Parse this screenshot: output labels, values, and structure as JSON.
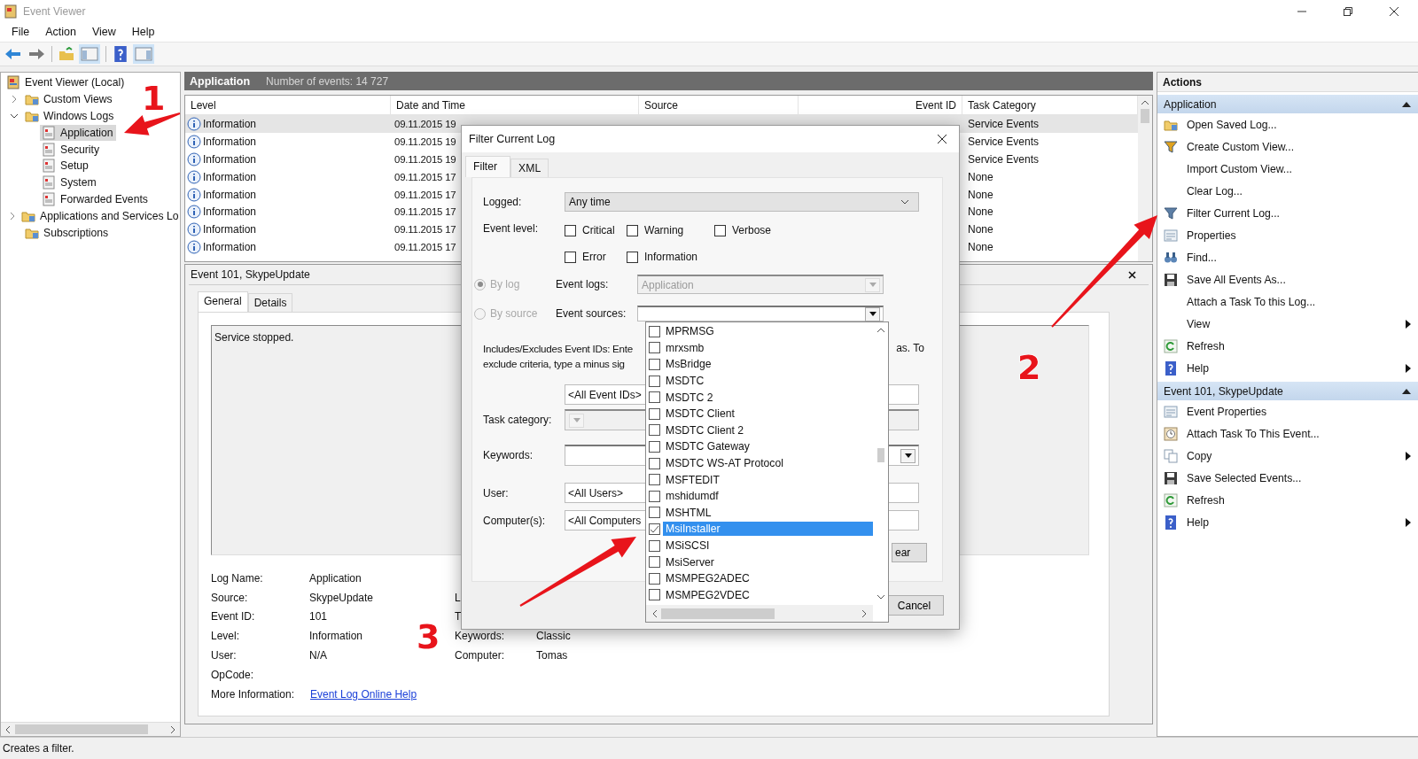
{
  "window": {
    "title": "Event Viewer"
  },
  "menu": [
    "File",
    "Action",
    "View",
    "Help"
  ],
  "tree": [
    {
      "label": "Event Viewer (Local)",
      "kind": "root",
      "selected": false,
      "children": [
        {
          "label": "Custom Views",
          "kind": "folder",
          "expanded": false,
          "selected": false
        },
        {
          "label": "Windows Logs",
          "kind": "folder",
          "expanded": true,
          "selected": false,
          "children": [
            {
              "label": "Application",
              "kind": "log",
              "selected": true
            },
            {
              "label": "Security",
              "kind": "log",
              "selected": false
            },
            {
              "label": "Setup",
              "kind": "log",
              "selected": false
            },
            {
              "label": "System",
              "kind": "log",
              "selected": false
            },
            {
              "label": "Forwarded Events",
              "kind": "log",
              "selected": false
            }
          ]
        },
        {
          "label": "Applications and Services Lo",
          "kind": "folder",
          "expanded": false,
          "selected": false
        },
        {
          "label": "Subscriptions",
          "kind": "plain-folder",
          "selected": false
        }
      ]
    }
  ],
  "log_header": {
    "name": "Application",
    "count": "Number of events: 14 727"
  },
  "events": {
    "columns": [
      "Level",
      "Date and Time",
      "Source",
      "Event ID",
      "Task Category"
    ],
    "rows": [
      {
        "level": "Information",
        "date_time": "09.11.2015 19",
        "task_category": "Service Events",
        "selected": true
      },
      {
        "level": "Information",
        "date_time": "09.11.2015 19",
        "task_category": "Service Events",
        "selected": false
      },
      {
        "level": "Information",
        "date_time": "09.11.2015 19",
        "task_category": "Service Events",
        "selected": false
      },
      {
        "level": "Information",
        "date_time": "09.11.2015 17",
        "task_category": "None",
        "selected": false
      },
      {
        "level": "Information",
        "date_time": "09.11.2015 17",
        "task_category": "None",
        "selected": false
      },
      {
        "level": "Information",
        "date_time": "09.11.2015 17",
        "task_category": "None",
        "selected": false
      },
      {
        "level": "Information",
        "date_time": "09.11.2015 17",
        "task_category": "None",
        "selected": false
      },
      {
        "level": "Information",
        "date_time": "09.11.2015 17",
        "task_category": "None",
        "selected": false
      }
    ]
  },
  "preview": {
    "title": "Event 101, SkypeUpdate",
    "tabs": [
      {
        "label": "General",
        "selected": true
      },
      {
        "label": "Details",
        "selected": false
      }
    ],
    "message": "Service stopped.",
    "fields": [
      {
        "label": "Log Name:",
        "value": "Application"
      },
      {
        "label": "Source:",
        "value": "SkypeUpdate",
        "right_label": "L"
      },
      {
        "label": "Event ID:",
        "value": "101",
        "right_label": "T"
      },
      {
        "label": "Level:",
        "value": "Information",
        "right_label": "Keywords:",
        "right_value": "Classic"
      },
      {
        "label": "User:",
        "value": "N/A",
        "right_label": "Computer:",
        "right_value": "Tomas"
      },
      {
        "label": "OpCode:"
      }
    ],
    "more_info_label": "More Information:",
    "more_info_link": "Event Log Online Help"
  },
  "dialog": {
    "title": "Filter Current Log",
    "tabs": [
      {
        "label": "Filter",
        "selected": true
      },
      {
        "label": "XML",
        "selected": false
      }
    ],
    "logged_label": "Logged:",
    "logged_value": "Any time",
    "event_level_label": "Event level:",
    "levels": [
      {
        "label": "Critical",
        "checked": false
      },
      {
        "label": "Warning",
        "checked": false
      },
      {
        "label": "Verbose",
        "checked": false
      },
      {
        "label": "Error",
        "checked": false
      },
      {
        "label": "Information",
        "checked": false
      }
    ],
    "radios": [
      {
        "label": "By log",
        "selected": true,
        "disabled": true
      },
      {
        "label": "By source",
        "selected": false,
        "disabled": true
      }
    ],
    "event_logs_label": "Event logs:",
    "event_logs_value": "Application",
    "event_sources_label": "Event sources:",
    "ids_text_line_1": "Includes/Excludes Event IDs: Ente",
    "ids_text_line_2": "exclude criteria, type a minus sig",
    "ids_text_right": "as. To",
    "event_ids_value": "<All Event IDs>",
    "task_category_label": "Task category:",
    "keywords_label": "Keywords:",
    "user_label": "User:",
    "user_value": "<All Users>",
    "computer_label": "Computer(s):",
    "computer_value": "<All Computers",
    "clear_button": "ear",
    "cancel_button": "Cancel",
    "source_list": [
      {
        "label": "MPRMSG",
        "checked": false,
        "selected": false
      },
      {
        "label": "mrxsmb",
        "checked": false,
        "selected": false
      },
      {
        "label": "MsBridge",
        "checked": false,
        "selected": false
      },
      {
        "label": "MSDTC",
        "checked": false,
        "selected": false
      },
      {
        "label": "MSDTC 2",
        "checked": false,
        "selected": false
      },
      {
        "label": "MSDTC Client",
        "checked": false,
        "selected": false
      },
      {
        "label": "MSDTC Client 2",
        "checked": false,
        "selected": false
      },
      {
        "label": "MSDTC Gateway",
        "checked": false,
        "selected": false
      },
      {
        "label": "MSDTC WS-AT Protocol",
        "checked": false,
        "selected": false
      },
      {
        "label": "MSFTEDIT",
        "checked": false,
        "selected": false
      },
      {
        "label": "mshidumdf",
        "checked": false,
        "selected": false
      },
      {
        "label": "MSHTML",
        "checked": false,
        "selected": false
      },
      {
        "label": "MsiInstaller",
        "checked": true,
        "selected": true
      },
      {
        "label": "MSiSCSI",
        "checked": false,
        "selected": false
      },
      {
        "label": "MsiServer",
        "checked": false,
        "selected": false
      },
      {
        "label": "MSMPEG2ADEC",
        "checked": false,
        "selected": false
      },
      {
        "label": "MSMPEG2VDEC",
        "checked": false,
        "selected": false
      }
    ]
  },
  "actions": {
    "title": "Actions",
    "sections": [
      {
        "title": "Application",
        "expanded": true,
        "items": [
          {
            "label": "Open Saved Log...",
            "submenu": false
          },
          {
            "label": "Create Custom View...",
            "submenu": false
          },
          {
            "label": "Import Custom View...",
            "submenu": false
          },
          {
            "label": "Clear Log...",
            "submenu": false
          },
          {
            "label": "Filter Current Log...",
            "submenu": false
          },
          {
            "label": "Properties",
            "submenu": false
          },
          {
            "label": "Find...",
            "submenu": false
          },
          {
            "label": "Save All Events As...",
            "submenu": false
          },
          {
            "label": "Attach a Task To this Log...",
            "submenu": false
          },
          {
            "label": "View",
            "submenu": true
          },
          {
            "label": "Refresh",
            "submenu": false
          },
          {
            "label": "Help",
            "submenu": true
          }
        ]
      },
      {
        "title": "Event 101, SkypeUpdate",
        "expanded": true,
        "items": [
          {
            "label": "Event Properties",
            "submenu": false
          },
          {
            "label": "Attach Task To This Event...",
            "submenu": false
          },
          {
            "label": "Copy",
            "submenu": true
          },
          {
            "label": "Save Selected Events...",
            "submenu": false
          },
          {
            "label": "Refresh",
            "submenu": false
          },
          {
            "label": "Help",
            "submenu": true
          }
        ]
      }
    ]
  },
  "annotations": [
    {
      "number": "1"
    },
    {
      "number": "2"
    },
    {
      "number": "3"
    }
  ],
  "status_bar": "Creates a filter."
}
